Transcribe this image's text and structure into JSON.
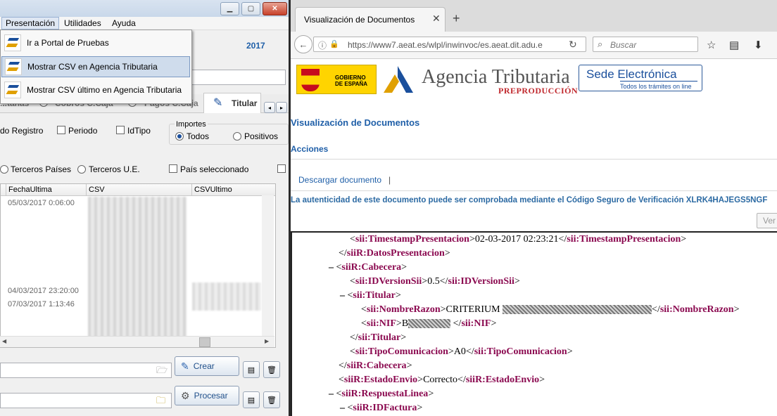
{
  "app": {
    "menu": [
      "Presentación",
      "Utilidades",
      "Ayuda"
    ],
    "year": "2017",
    "dropdown": [
      "Ir a Portal de Pruebas",
      "Mostrar CSV en Agencia Tributaria",
      "Mostrar CSV último en Agencia Tributaria"
    ],
    "tabs": [
      "...tanas",
      "Cobros C.Caja",
      "Pagos C.Caja",
      "Titular"
    ],
    "filters": {
      "registro": "do Registro",
      "periodo": "Periodo",
      "idtipo": "IdTipo",
      "importes_group": "Importes",
      "todos": "Todos",
      "positivos": "Positivos",
      "terceros_paises": "Terceros Países",
      "terceros_ue": "Terceros U.E.",
      "pais_sel": "País seleccionado"
    },
    "grid": {
      "headers": [
        "FechaUltima",
        "CSV",
        "CSVUltimo"
      ],
      "dates": [
        "05/03/2017 0:06:00",
        "04/03/2017 23:20:00",
        "07/03/2017 1:13:46"
      ]
    },
    "buttons": {
      "crear": "Crear",
      "procesar": "Procesar"
    }
  },
  "browser": {
    "tab_title": "Visualización de Documentos",
    "url": "https://www7.aeat.es/wlpl/inwinvoc/es.aeat.dit.adu.e",
    "search_placeholder": "Buscar",
    "header": {
      "gobierno": "GOBIERNO DE ESPAÑA",
      "agencia": "Agencia Tributaria",
      "preproduccion": "PREPRODUCCIÓN",
      "sede": "Sede Electrónica",
      "sede_sub": "Todos los trámites on line"
    },
    "page_title": "Visualización de Documentos",
    "acciones": "Acciones",
    "descargar": "Descargar documento",
    "csv_notice": "La autenticidad de este documento puede ser comprobada mediante el Código Seguro de Verificación XLRK4HAJEGS5NGF",
    "ver_button": "Ver",
    "xml": {
      "timestamp": "02-03-2017 02:23:21",
      "version": "0.5",
      "nombre_prefix": "CRITERIUM ",
      "nif_prefix": "B",
      "tipo": "A0",
      "estado": "Correcto"
    }
  },
  "colors": {
    "aeat_blue": "#1f5fa8",
    "xml_tag": "#8b0a50",
    "pre_red": "#c0282d"
  }
}
